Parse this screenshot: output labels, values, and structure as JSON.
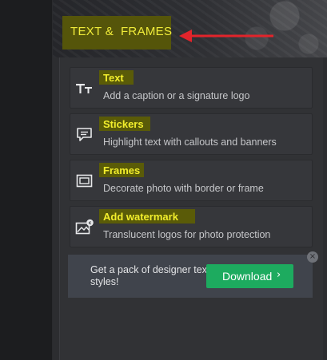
{
  "panel": {
    "title": "TEXT &  FRAMES"
  },
  "items": [
    {
      "name": "Text",
      "desc": "Add a caption or a signature logo",
      "icon": "text-size-icon"
    },
    {
      "name": "Stickers",
      "desc": "Highlight text with callouts and banners",
      "icon": "speech-bubble-icon"
    },
    {
      "name": "Frames",
      "desc": "Decorate photo with border or frame",
      "icon": "frame-icon"
    },
    {
      "name": "Add watermark",
      "desc": "Translucent logos for photo protection",
      "icon": "image-copyright-icon"
    }
  ],
  "promo": {
    "text": "Get a pack of designer text styles!",
    "button_label": "Download",
    "button_chevron": "›",
    "close_glyph": "×"
  },
  "colors": {
    "accent_highlight": "#f0ec3a",
    "download_green": "#1dab5f",
    "annotation_arrow": "#e2242b"
  }
}
